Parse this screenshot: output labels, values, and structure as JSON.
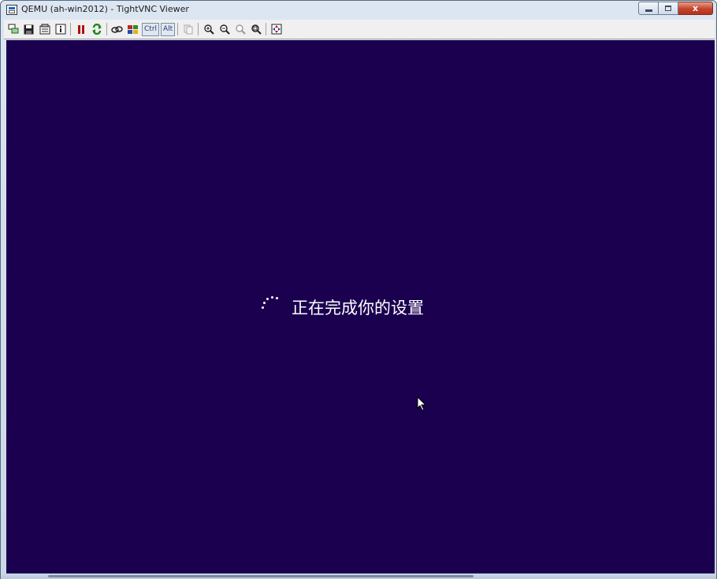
{
  "window": {
    "title": "QEMU (ah-win2012) - TightVNC Viewer",
    "controls": {
      "minimize": "minimize",
      "maximize": "maximize",
      "close": "x"
    }
  },
  "toolbar": {
    "items": [
      {
        "icon": "new-connection-icon"
      },
      {
        "icon": "save-icon"
      },
      {
        "icon": "options-icon"
      },
      {
        "icon": "info-icon"
      },
      {
        "icon": "pause-icon"
      },
      {
        "icon": "refresh-icon"
      },
      {
        "icon": "ctrl-alt-del-icon"
      },
      {
        "icon": "win-key-icon"
      },
      {
        "label": "Ctrl"
      },
      {
        "label": "Alt"
      },
      {
        "icon": "clipboard-icon"
      },
      {
        "icon": "zoom-in-icon"
      },
      {
        "icon": "zoom-out-icon"
      },
      {
        "icon": "zoom-100-icon"
      },
      {
        "icon": "zoom-fit-icon"
      },
      {
        "icon": "fullscreen-icon"
      }
    ],
    "ctrl_label": "Ctrl",
    "alt_label": "Alt"
  },
  "remote_screen": {
    "background_color": "#1b0050",
    "status_text": "正在完成你的设置"
  },
  "colors": {
    "close_button": "#c5432b",
    "screen_background": "#1b0050",
    "text": "#ffffff"
  }
}
